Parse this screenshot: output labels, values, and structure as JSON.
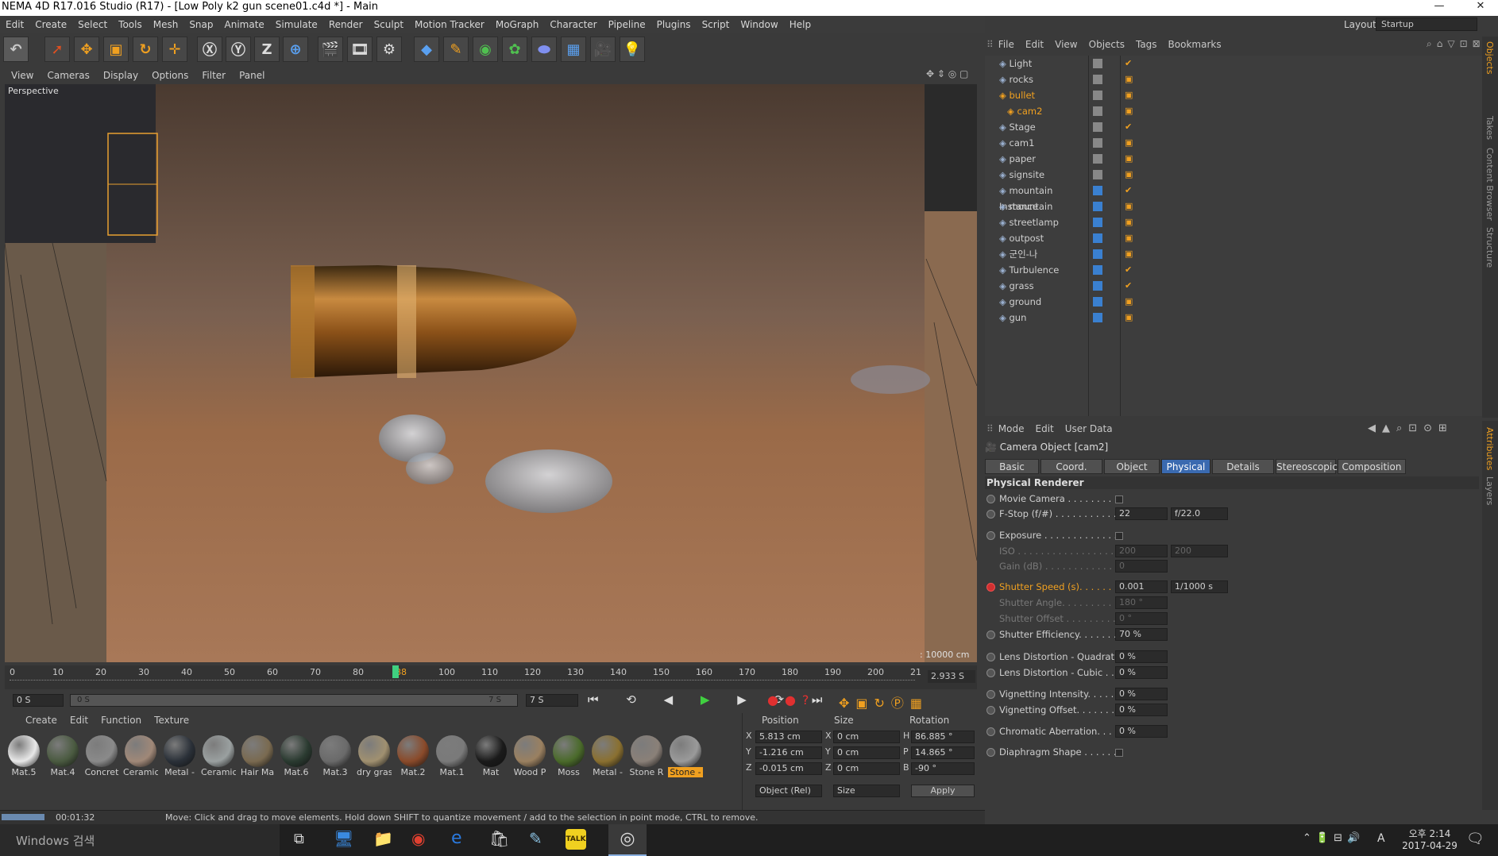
{
  "window": {
    "title": "NEMA 4D R17.016 Studio (R17) - [Low Poly k2 gun scene01.c4d *] - Main",
    "minimize": "—",
    "maximize": "❐",
    "close": "✕"
  },
  "menu": [
    "Edit",
    "Create",
    "Select",
    "Tools",
    "Mesh",
    "Snap",
    "Animate",
    "Simulate",
    "Render",
    "Sculpt",
    "Motion Tracker",
    "MoGraph",
    "Character",
    "Pipeline",
    "Plugins",
    "Script",
    "Window",
    "Help"
  ],
  "layout": {
    "label": "Layout:",
    "value": "Startup"
  },
  "viewport": {
    "menu": [
      "View",
      "Cameras",
      "Display",
      "Options",
      "Filter",
      "Panel"
    ],
    "label": "Perspective",
    "scale": ": 10000 cm"
  },
  "timeline": {
    "ticks": [
      "0",
      "10",
      "20",
      "30",
      "40",
      "50",
      "60",
      "70",
      "80",
      "88",
      "100",
      "110",
      "120",
      "130",
      "140",
      "150",
      "160",
      "170",
      "180",
      "190",
      "200",
      "21"
    ],
    "current_time": "2.933 S",
    "start": "0 S",
    "range_start": "0 S",
    "range_end": "7 S",
    "end": "7 S"
  },
  "material_manager": {
    "menu": [
      "Create",
      "Edit",
      "Function",
      "Texture"
    ],
    "materials": [
      {
        "label": "Mat.5",
        "color": "#e8e8e8"
      },
      {
        "label": "Mat.4",
        "color": "#4a5a40"
      },
      {
        "label": "Concret",
        "color": "#8a8a8a"
      },
      {
        "label": "Ceramic",
        "color": "#a08878"
      },
      {
        "label": "Metal -",
        "color": "#2a3038"
      },
      {
        "label": "Ceramic",
        "color": "#9aa0a0"
      },
      {
        "label": "Hair Ma",
        "color": "#7a6a50"
      },
      {
        "label": "Mat.6",
        "color": "#2a3a30"
      },
      {
        "label": "Mat.3",
        "color": "#6a6a6a"
      },
      {
        "label": "dry gras",
        "color": "#a09070"
      },
      {
        "label": "Mat.2",
        "color": "#8a4a2a"
      },
      {
        "label": "Mat.1",
        "color": "#7a7a7a"
      },
      {
        "label": "Mat",
        "color": "#1a1a1a"
      },
      {
        "label": "Wood P",
        "color": "#9a8060"
      },
      {
        "label": "Moss",
        "color": "#4a6a2a"
      },
      {
        "label": "Metal -",
        "color": "#8a7030"
      },
      {
        "label": "Stone R",
        "color": "#8a8078"
      },
      {
        "label": "Stone -",
        "color": "#9a9a9a"
      }
    ]
  },
  "coordinates": {
    "headers": [
      "Position",
      "Size",
      "Rotation"
    ],
    "rows": [
      {
        "axis": "X",
        "pos": "5.813 cm",
        "size_axis": "X",
        "size": "0 cm",
        "rot_axis": "H",
        "rot": "86.885 °"
      },
      {
        "axis": "Y",
        "pos": "-1.216 cm",
        "size_axis": "Y",
        "size": "0 cm",
        "rot_axis": "P",
        "rot": "14.865 °"
      },
      {
        "axis": "Z",
        "pos": "-0.015 cm",
        "size_axis": "Z",
        "size": "0 cm",
        "rot_axis": "B",
        "rot": "-90 °"
      }
    ],
    "mode": "Object (Rel)",
    "size_mode": "Size",
    "apply": "Apply"
  },
  "status": {
    "time": "00:01:32",
    "message": "Move: Click and drag to move elements. Hold down SHIFT to quantize movement / add to the selection in point mode, CTRL to remove."
  },
  "object_manager": {
    "menu": [
      "File",
      "Edit",
      "View",
      "Objects",
      "Tags",
      "Bookmarks"
    ],
    "objects": [
      {
        "name": "Light",
        "selected": false
      },
      {
        "name": "rocks",
        "selected": false
      },
      {
        "name": "bullet",
        "selected": true
      },
      {
        "name": "cam2",
        "selected": true
      },
      {
        "name": "Stage",
        "selected": false
      },
      {
        "name": "cam1",
        "selected": false
      },
      {
        "name": "paper",
        "selected": false
      },
      {
        "name": "signsite",
        "selected": false
      },
      {
        "name": "mountain Instance",
        "selected": false
      },
      {
        "name": "mountain",
        "selected": false
      },
      {
        "name": "streetlamp",
        "selected": false
      },
      {
        "name": "outpost",
        "selected": false
      },
      {
        "name": "군인-나",
        "selected": false
      },
      {
        "name": "Turbulence",
        "selected": false
      },
      {
        "name": "grass",
        "selected": false
      },
      {
        "name": "ground",
        "selected": false
      },
      {
        "name": "gun",
        "selected": false
      }
    ]
  },
  "side_tabs": [
    "Objects",
    "Takes",
    "Content Browser",
    "Structure"
  ],
  "side_tabs2": [
    "Attributes",
    "Layers"
  ],
  "attributes": {
    "menu": [
      "Mode",
      "Edit",
      "User Data"
    ],
    "title": "Camera Object [cam2]",
    "tabs": [
      "Basic",
      "Coord.",
      "Object",
      "Physical",
      "Details",
      "Stereoscopic",
      "Composition"
    ],
    "active_tab": "Physical",
    "section": "Physical Renderer",
    "props": {
      "movie_camera": "Movie Camera . . . . . . . . . . .",
      "fstop": "F-Stop (f/#) . . . . . . . . . . . . . .",
      "fstop_val": "22",
      "fstop_preset": "f/22.0",
      "exposure": "Exposure . . . . . . . . . . . . . . .",
      "iso": "ISO . . . . . . . . . . . . . . . . . . . .",
      "iso_val": "200",
      "iso_preset": "200",
      "gain": "Gain (dB) . . . . . . . . . . . . . . .",
      "gain_val": "0",
      "shutter_speed": "Shutter Speed (s). . . . . . . . .",
      "shutter_speed_val": "0.001",
      "shutter_speed_preset": "1/1000 s",
      "shutter_angle": "Shutter Angle. . . . . . . . . . . .",
      "shutter_angle_val": "180 °",
      "shutter_offset": "Shutter Offset . . . . . . . . . . .",
      "shutter_offset_val": "0 °",
      "shutter_eff": "Shutter Efficiency. . . . . . . . .",
      "shutter_eff_val": "70 %",
      "lens_quad": "Lens Distortion - Quadratic",
      "lens_quad_val": "0 %",
      "lens_cubic": "Lens Distortion - Cubic . . .",
      "lens_cubic_val": "0 %",
      "vig_int": "Vignetting Intensity. . . . . .",
      "vig_int_val": "0 %",
      "vig_off": "Vignetting Offset. . . . . . . .",
      "vig_off_val": "0 %",
      "chrom": "Chromatic Aberration. . . . .",
      "chrom_val": "0 %",
      "diaphragm": "Diaphragm Shape . . . . . ."
    }
  },
  "taskbar": {
    "search": "Windows 검색",
    "time": "오후 2:14",
    "date": "2017-04-29",
    "ime": "A"
  }
}
